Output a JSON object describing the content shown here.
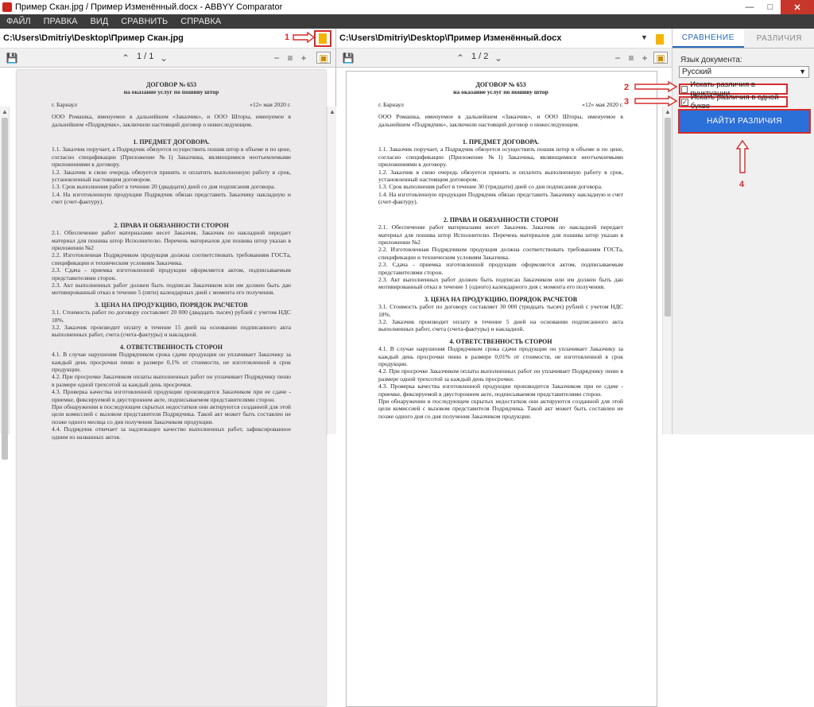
{
  "window": {
    "title": "Пример Скан.jpg / Пример Изменённый.docx - ABBYY Comparator"
  },
  "menu": [
    "ФАЙЛ",
    "ПРАВКА",
    "ВИД",
    "СРАВНИТЬ",
    "СПРАВКА"
  ],
  "left": {
    "path": "C:\\Users\\Dmitriy\\Desktop\\Пример Скан.jpg",
    "pager": "1 / 1"
  },
  "right": {
    "path": "C:\\Users\\Dmitriy\\Desktop\\Пример Изменённый.docx",
    "pager": "1 / 2"
  },
  "panel": {
    "tab_compare": "СРАВНЕНИЕ",
    "tab_diff": "РАЗЛИЧИЯ",
    "lang_label": "Язык документа:",
    "lang_value": "Русский",
    "chk_punct": "Искать различия в пунктуации",
    "chk_punct_checked": false,
    "chk_letter": "Искать различия в одной букве",
    "chk_letter_checked": true,
    "find_button": "НАЙТИ РАЗЛИЧИЯ"
  },
  "annotations": [
    "1",
    "2",
    "3",
    "4"
  ],
  "colors": {
    "accent": "#2b6fd8",
    "annotation": "#d62b2b",
    "menubar": "#3c3c3c"
  },
  "doc_left": {
    "title": "ДОГОВОР № 653",
    "subtitle": "на оказание услуг по пошиву штор",
    "city": "г. Барнаул",
    "date": "«12» мая 2020 г.",
    "intro": "ООО Ромашка, именуемое в дальнейшем «Заказчик», и ООО Шторы, именуемое в дальнейшем «Подрядчик», заключили настоящий договор о нижеследующем.",
    "h1": "1. ПРЕДМЕТ ДОГОВОРА.",
    "p1": [
      "1.1. Заказчик поручает, а Подрядчик обязуется осуществить пошив штор в объеме и по цене, согласно спецификации (Приложение №1) Заказчика, являющимися неотъемлемыми приложениями к договору.",
      "1.2. Заказчик в свою очередь обязуется принять и оплатить выполненную работу в срок, установленный настоящим договором.",
      "1.3. Срок выполнения работ в течение 20 (двадцати) дней со дня подписания договора.",
      "1.4. На изготовленную продукции Подрядчик обязан представить Заказчику накладную и счет (счет-фактуру)."
    ],
    "h2": "2. ПРАВА И ОБЯЗАННОСТИ СТОРОН",
    "p2": [
      "2.1. Обеспечение работ материалами несет Заказчик. Заказчик по накладной передает материал для пошива штор Исполнителю. Перечень материалов для пошива штор указан в приложении №2",
      "2.2. Изготовленная Подрядчиком продукция должна соответствовать требованиям ГОСТа, спецификации и техническим условиям Заказчика.",
      "2.3. Сдача - приемка изготовленной продукции оформляется актом, подписываемым представителями сторон.",
      "2.3. Акт выполненных работ должен быть подписан Заказчиком или им должен быть дан мотивированный отказ в течение 5 (пяти) календарных дней с момента его получения."
    ],
    "h3": "3. ЦЕНА НА ПРОДУКЦИЮ, ПОРЯДОК РАСЧЕТОВ",
    "p3": [
      "3.1. Стоимость работ по договору составляет 20 000 (двадцать тысяч) рублей с учетом НДС 18%.",
      "3.2. Заказчик производит оплату в течение 15 дней на основании подписанного акта выполненных работ, счета (счета-фактуры) и накладной."
    ],
    "h4": "4. ОТВЕТСТВЕННОСТЬ СТОРОН",
    "p4": [
      "4.1. В случае нарушения Подрядчиком срока сдачи продукции он уплачивает Заказчику за каждый день просрочки пеню в размере 0,1% от стоимости, не изготовленной в срок продукции.",
      "4.2. При просрочке Заказчиком оплаты выполненных работ он уплачивает Подрядчику пеню в размере одной трехсотой за каждый день просрочки.",
      "4.3. Проверка качества изготовленной продукции производится Заказчиком при ее сдаче - приемке, фиксируемой в двустороннем акте, подписываемом представителями сторон.",
      "При обнаружении в последующем скрытых недостатков они актируются созданной для этой цели комиссией с вызовом представителя Подрядчика. Такой акт может быть составлен не позже одного месяца со дня получения Заказчиком продукции.",
      "4.4. Подрядчик отвечает за надлежащее качество выполненных работ, зафиксированное одним из названных актов."
    ]
  },
  "doc_right": {
    "title": "ДОГОВОР № 653",
    "subtitle": "на оказание услуг по пошиву штор",
    "city": "г. Барнаул",
    "date": "«12» мая 2020 г.",
    "intro": "ООО Ромашка, именуемое в дальнейшем «Заказчик», и ООО Шторы, именуемое в дальнейшем «Подрядчик», заключили настоящий договор о нижеследующем.",
    "h1": "1. ПРЕДМЕТ ДОГОВОРА.",
    "p1": [
      "1.1. Заказчик поручает, а Подрядчик обязуется осуществить пошив штор в объеме и по цене, согласно спецификации (Приложение №1) Заказчика, являющимися неотъемлемыми приложениями к договору.",
      "1.2. Заказчик в свою очередь обязуется принять и оплатить выполненную работу в срок, установленный настоящим договором.",
      "1.3. Срок выполнения работ в течение 30 (тридцати) дней со дня подписания договора.",
      "1.4. На изготовленную продукции Подрядчик обязан представить Заказчику накладную и счет (счет-фактуру)."
    ],
    "h2": "2. ПРАВА И ОБЯЗАННОСТИ СТОРОН",
    "p2": [
      "2.1. Обеспечение работ материалами несет Заказчик. Заказчик по накладной передает материал для пошива штор Исполнителю. Перечень материалов для пошива штор указан в приложении №2",
      "2.2. Изготовленная Подрядчиком продукция должна соответствовать требованиям ГОСТа, спецификации и техническим условиям Заказчика.",
      "2.3. Сдача - приемка изготовленной продукции оформляется актом, подписываемым представителями сторон.",
      "2.3. Акт выполненных работ должен быть подписан Заказчиком или им должен быть дан мотивированный отказ в течение 1 (одного) календарного дня с момента его получения."
    ],
    "h3": "3. ЦЕНА НА ПРОДУКЦИЮ, ПОРЯДОК РАСЧЕТОВ",
    "p3": [
      "3.1. Стоимость работ по договору составляет 30 000 (тридцать тысяч) рублей с учетом НДС 18%.",
      "3.2. Заказчик производит оплату в течение 5 дней на основании подписанного акта выполненных работ, счета (счета-фактуры) и накладной."
    ],
    "h4": "4. ОТВЕТСТВЕННОСТЬ СТОРОН",
    "p4": [
      "4.1. В случае нарушения Подрядчиком срока сдачи продукции он уплачивает Заказчику за каждый день просрочки пеню в размере 0,01% от стоимости, не изготовленной в срок продукции.",
      "4.2. При просрочке Заказчиком оплаты выполненных работ он уплачивает Подрядчику пеню в размере одной трехсотой за каждый день просрочки.",
      "4.3. Проверка качества изготовленной продукции производится Заказчиком при ее сдаче - приемке, фиксируемой в двустороннем акте, подписываемом представителями сторон.",
      "При обнаружении в последующем скрытых недостатков они актируются созданной для этой цели комиссией с вызовом представителя Подрядчика. Такой акт может быть составлен не позже одного дня со дня получения Заказчиком продукции."
    ]
  }
}
